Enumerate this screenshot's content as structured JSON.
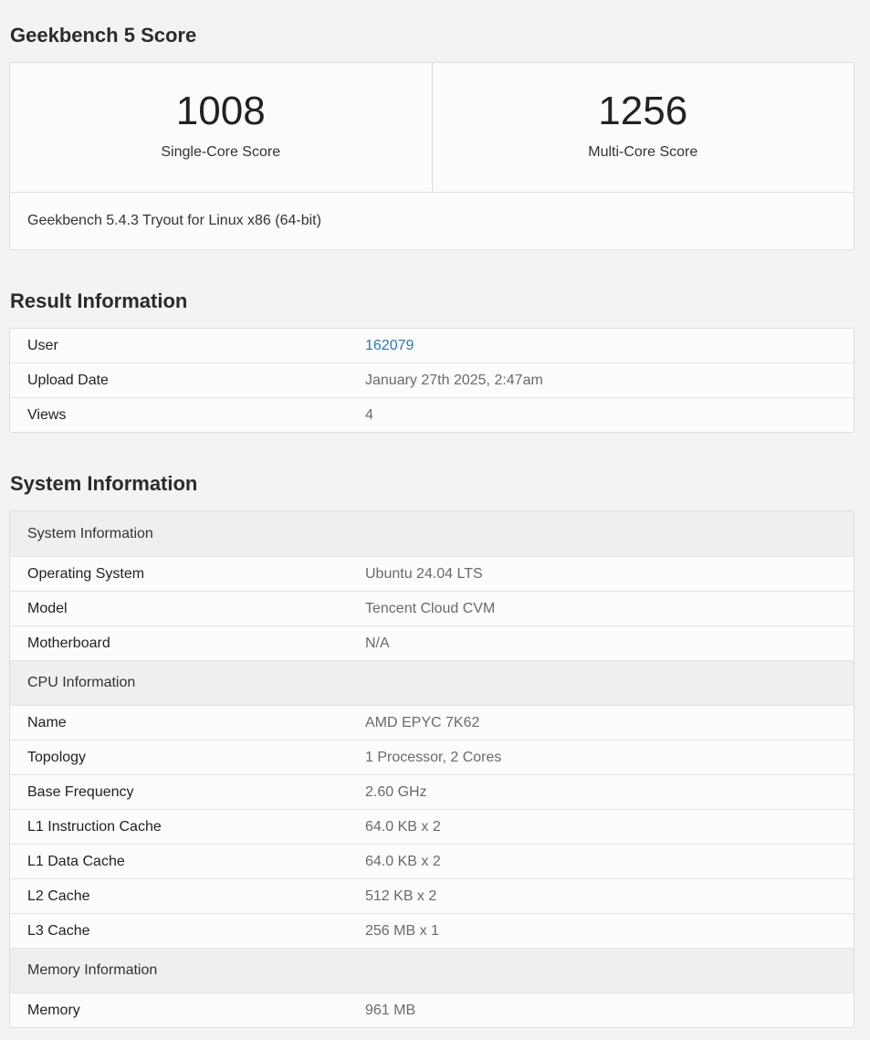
{
  "score_section": {
    "title": "Geekbench 5 Score",
    "single_core": {
      "value": "1008",
      "label": "Single-Core Score"
    },
    "multi_core": {
      "value": "1256",
      "label": "Multi-Core Score"
    },
    "platform": "Geekbench 5.4.3 Tryout for Linux x86 (64-bit)"
  },
  "result_section": {
    "title": "Result Information",
    "rows": [
      {
        "key": "User",
        "value": "162079"
      },
      {
        "key": "Upload Date",
        "value": "January 27th 2025, 2:47am"
      },
      {
        "key": "Views",
        "value": "4"
      }
    ]
  },
  "system_section": {
    "title": "System Information",
    "groups": [
      {
        "header": "System Information",
        "rows": [
          {
            "key": "Operating System",
            "value": "Ubuntu 24.04 LTS"
          },
          {
            "key": "Model",
            "value": "Tencent Cloud CVM"
          },
          {
            "key": "Motherboard",
            "value": "N/A"
          }
        ]
      },
      {
        "header": "CPU Information",
        "rows": [
          {
            "key": "Name",
            "value": "AMD EPYC 7K62"
          },
          {
            "key": "Topology",
            "value": "1 Processor, 2 Cores"
          },
          {
            "key": "Base Frequency",
            "value": "2.60 GHz"
          },
          {
            "key": "L1 Instruction Cache",
            "value": "64.0 KB x 2"
          },
          {
            "key": "L1 Data Cache",
            "value": "64.0 KB x 2"
          },
          {
            "key": "L2 Cache",
            "value": "512 KB x 2"
          },
          {
            "key": "L3 Cache",
            "value": "256 MB x 1"
          }
        ]
      },
      {
        "header": "Memory Information",
        "rows": [
          {
            "key": "Memory",
            "value": "961 MB"
          }
        ]
      }
    ]
  },
  "colors": {
    "link": "#2a77b8",
    "background": "#f3f3f3",
    "card": "#fcfcfc"
  }
}
